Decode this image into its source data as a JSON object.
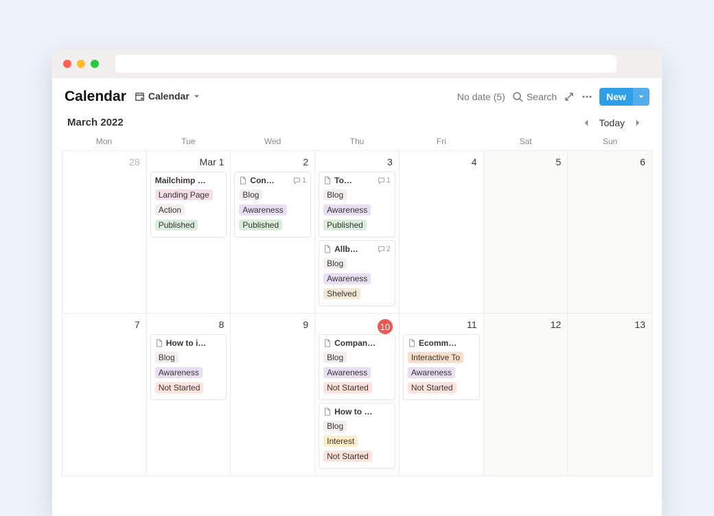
{
  "header": {
    "title": "Calendar",
    "view_label": "Calendar",
    "no_date": "No date (5)",
    "search": "Search",
    "new_label": "New"
  },
  "monthbar": {
    "label": "March 2022",
    "today": "Today"
  },
  "dow": [
    "Mon",
    "Tue",
    "Wed",
    "Thu",
    "Fri",
    "Sat",
    "Sun"
  ],
  "days": {
    "r1": [
      "28",
      "Mar 1",
      "2",
      "3",
      "4",
      "5",
      "6"
    ],
    "r2": [
      "7",
      "8",
      "9",
      "10",
      "11",
      "12",
      "13"
    ]
  },
  "cards": {
    "mar1_a": {
      "title": "Mailchimp …",
      "tags": [
        [
          "Landing Page",
          "landing"
        ],
        [
          "Action",
          "action"
        ],
        [
          "Published",
          "published"
        ]
      ]
    },
    "mar2_a": {
      "title": "Con…",
      "comments": "1",
      "tags": [
        [
          "Blog",
          "blog"
        ],
        [
          "Awareness",
          "awareness"
        ],
        [
          "Published",
          "published"
        ]
      ]
    },
    "mar3_a": {
      "title": "To…",
      "comments": "1",
      "tags": [
        [
          "Blog",
          "blog"
        ],
        [
          "Awareness",
          "awareness"
        ],
        [
          "Published",
          "published"
        ]
      ]
    },
    "mar3_b": {
      "title": "Allb…",
      "comments": "2",
      "tags": [
        [
          "Blog",
          "blog"
        ],
        [
          "Awareness",
          "awareness"
        ],
        [
          "Shelved",
          "shelved"
        ]
      ]
    },
    "mar8_a": {
      "title": "How to i…",
      "tags": [
        [
          "Blog",
          "blog"
        ],
        [
          "Awareness",
          "awareness"
        ],
        [
          "Not Started",
          "notstarted"
        ]
      ]
    },
    "mar10_a": {
      "title": "Compan…",
      "tags": [
        [
          "Blog",
          "blog"
        ],
        [
          "Awareness",
          "awareness"
        ],
        [
          "Not Started",
          "notstarted"
        ]
      ]
    },
    "mar10_b": {
      "title": "How to …",
      "tags": [
        [
          "Blog",
          "blog"
        ],
        [
          "Interest",
          "interest"
        ],
        [
          "Not Started",
          "notstarted"
        ]
      ]
    },
    "mar11_a": {
      "title": "Ecomm…",
      "tags": [
        [
          "Interactive To",
          "int-tool"
        ],
        [
          "Awareness",
          "awareness"
        ],
        [
          "Not Started",
          "notstarted"
        ]
      ]
    }
  }
}
